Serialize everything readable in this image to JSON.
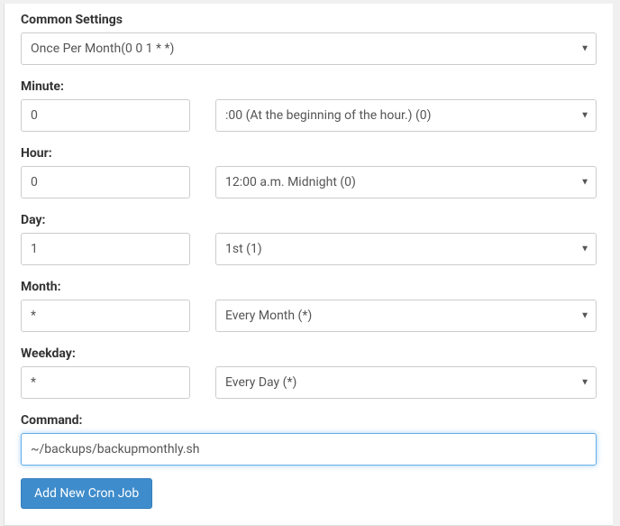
{
  "common_settings": {
    "label": "Common Settings",
    "selected": "Once Per Month(0 0 1 * *)"
  },
  "minute": {
    "label": "Minute:",
    "value": "0",
    "selected": ":00 (At the beginning of the hour.) (0)"
  },
  "hour": {
    "label": "Hour:",
    "value": "0",
    "selected": "12:00 a.m. Midnight (0)"
  },
  "day": {
    "label": "Day:",
    "value": "1",
    "selected": "1st (1)"
  },
  "month": {
    "label": "Month:",
    "value": "*",
    "selected": "Every Month (*)"
  },
  "weekday": {
    "label": "Weekday:",
    "value": "*",
    "selected": "Every Day (*)"
  },
  "command": {
    "label": "Command:",
    "value": "~/backups/backupmonthly.sh"
  },
  "submit": {
    "label": "Add New Cron Job"
  }
}
